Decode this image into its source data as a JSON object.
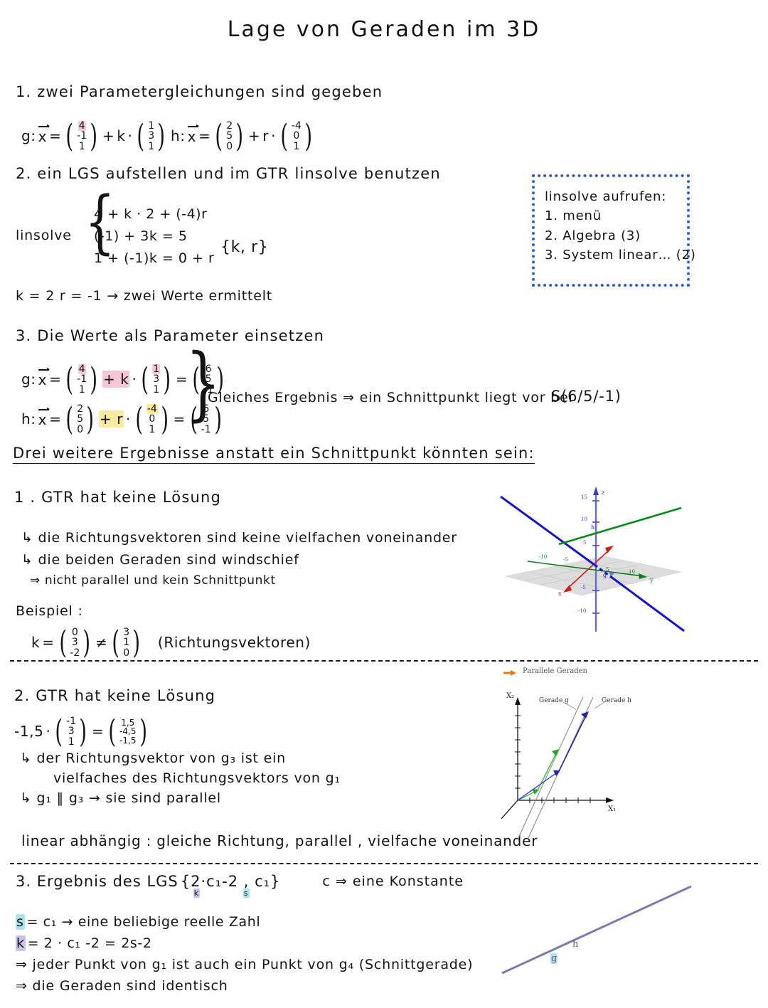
{
  "title": "Lage  von  Geraden  im  3D",
  "colors": {
    "pink_highlight": "#f7c7d8",
    "yellow_highlight": "#fbeaa0",
    "cyan_highlight": "#aee4ea",
    "purple_highlight": "#c8c3e8",
    "note_border_blue": "#2f5fd0",
    "line_blue": "#2222cc",
    "line_green": "#0a7a1e",
    "axis_red": "#d32020",
    "identical_line": "#7b7bb0"
  },
  "step1": {
    "heading": "1. zwei  Parametergleichungen  sind   gegeben",
    "g_label": "g:",
    "h_label": "h:",
    "x_vec": "x",
    "eq": "=",
    "plus": "+",
    "dot": "·",
    "g_support": [
      "4",
      "-1",
      "1"
    ],
    "g_direction": [
      "1",
      "3",
      "1"
    ],
    "g_param": "k",
    "h_support": [
      "2",
      "5",
      "0"
    ],
    "h_direction": [
      "-4",
      "0",
      "1"
    ],
    "h_param": "r"
  },
  "step2": {
    "heading": "2. ein  LGS  aufstellen  und  im  GTR   linsolve  benutzen",
    "linsolve_label": "linsolve",
    "equations": [
      "4 + k · 2 + (-4)r",
      "(-1) + 3k = 5",
      "1 + (-1)k = 0 + r"
    ],
    "solution_set": "{k, r}",
    "result_line": "k = 2   r = -1      → zwei Werte    ermittelt",
    "note": {
      "title": "linsolve  aufrufen:",
      "items": [
        "1. menü",
        "2. Algebra (3)",
        "3. System  linear… (2)"
      ]
    }
  },
  "step3": {
    "heading": "3. Die  Werte  als  Parameter  einsetzen",
    "g_label": "g:",
    "h_label": "h:",
    "g_support": [
      "4",
      "-1",
      "1"
    ],
    "g_direction": [
      "1",
      "3",
      "1"
    ],
    "g_result": [
      "6",
      "5",
      "-1"
    ],
    "g_param_term": "+ k",
    "h_support": [
      "2",
      "5",
      "0"
    ],
    "h_direction": [
      "-4",
      "0",
      "1"
    ],
    "h_result": [
      "6",
      "5",
      "-1"
    ],
    "h_param_term": "+ r",
    "conclusion": "Gleiches Ergebnis ⇒ ein  Schnittpunkt  liegt  vor bei",
    "intersection_point": "S(6/5/-1)"
  },
  "alternatives_heading": "Drei  weitere  Ergebnisse  anstatt  ein  Schnittpunkt  könnten  sein:",
  "case1": {
    "heading": "1 . GTR  hat  keine  Lösung",
    "bullets": [
      "↳ die  Richtungsvektoren  sind  keine  vielfachen  voneinander",
      "↳ die  beiden   Geraden  sind  windschief",
      "⇒ nicht parallel  und  kein   Schnittpunkt"
    ],
    "example_label": "Beispiel :",
    "example_param": "k",
    "example_eq": "=",
    "example_vec_a": [
      "0",
      "3",
      "-2"
    ],
    "example_neq": "≠",
    "example_vec_b": [
      "3",
      "1",
      "0"
    ],
    "example_note": "(Richtungsvektoren)",
    "figure": {
      "axis_labels": {
        "x": "x",
        "y": "y",
        "z": "z"
      },
      "z_ticks": [
        "15",
        "10",
        "5",
        "-5",
        "-10"
      ],
      "xy_ticks": [
        "-10",
        "-5",
        "5",
        "10"
      ],
      "line_labels": [
        "h",
        "g"
      ]
    }
  },
  "case2": {
    "heading": "2.  GTR  hat  keine  Lösung",
    "scalar": "-1,5",
    "dot": "·",
    "vec_in": [
      "-1",
      "3",
      "1"
    ],
    "eq": "=",
    "vec_out": [
      "1,5",
      "-4,5",
      "-1,5"
    ],
    "bullets": [
      "↳ der  Richtungsvektor  von   g₃ ist  ein",
      "vielfaches   des  Richtungsvektors  von  g₁",
      "↳ g₁ ‖ g₃  → sie  sind  parallel"
    ],
    "footer": "linear  abhängig : gleiche Richtung, parallel , vielfache  voneinander",
    "figure": {
      "legend": "Parallele Geraden",
      "y_axis": "X₂",
      "x_axis": "X₁",
      "label_g": "Gerade g",
      "label_h": "Gerade h"
    }
  },
  "case3": {
    "heading_prefix": "3. Ergebnis  des  LGS",
    "solution_set": "{2·c₁-2 , c₁}",
    "sub_k": "k",
    "sub_s": "s",
    "constant_note": "c ⇒ eine  Konstante",
    "lines": [
      {
        "lead": "s",
        "rest": "= c₁  → eine  beliebige  reelle  Zahl",
        "hl": "cyan"
      },
      {
        "lead": "k",
        "rest": "= 2 · c₁ -2  = 2s-2",
        "hl": "purple"
      },
      {
        "lead": "",
        "rest": "⇒ jeder Punkt  von  g₁ ist  auch ein Punkt  von  g₄ (Schnittgerade)",
        "hl": "none"
      },
      {
        "lead": "",
        "rest": "⇒ die  Geraden   sind   identisch",
        "hl": "none"
      }
    ],
    "figure": {
      "label_g": "g",
      "label_h": "h"
    }
  }
}
